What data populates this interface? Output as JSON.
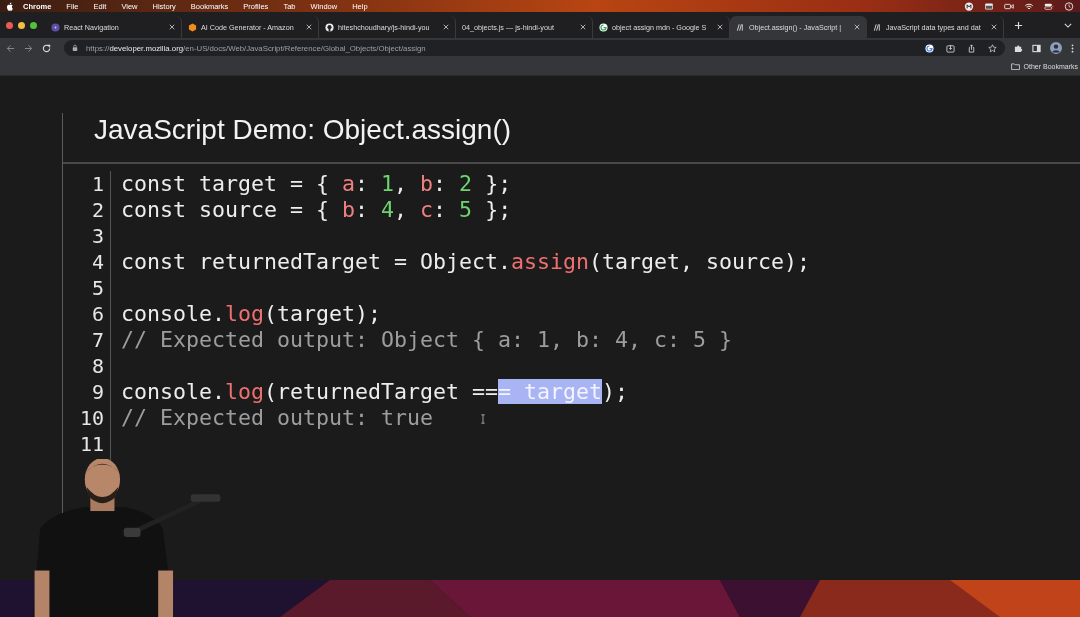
{
  "menu_bar": {
    "items": [
      {
        "label": "Chrome",
        "kind": "app"
      },
      {
        "label": "File",
        "kind": "menu"
      },
      {
        "label": "Edit",
        "kind": "menu"
      },
      {
        "label": "View",
        "kind": "menu"
      },
      {
        "label": "History",
        "kind": "menu"
      },
      {
        "label": "Bookmarks",
        "kind": "menu"
      },
      {
        "label": "Profiles",
        "kind": "menu"
      },
      {
        "label": "Tab",
        "kind": "menu"
      },
      {
        "label": "Window",
        "kind": "menu"
      },
      {
        "label": "Help",
        "kind": "menu"
      }
    ]
  },
  "tabs": [
    {
      "title": "React Navigation",
      "selected": false
    },
    {
      "title": "AI Code Generator - Amazon",
      "selected": false
    },
    {
      "title": "hiteshchoudhary/js-hindi-you",
      "selected": false
    },
    {
      "title": "04_objects.js — js-hindi-yout",
      "selected": false
    },
    {
      "title": "object assign mdn - Google S",
      "selected": false
    },
    {
      "title": "Object.assign() - JavaScript |",
      "selected": true
    },
    {
      "title": "JavaScript data types and dat",
      "selected": false
    }
  ],
  "address_bar": {
    "host_prefix": "https://",
    "host": "developer.mozilla.org",
    "path": "/en-US/docs/Web/JavaScript/Reference/Global_Objects/Object/assign"
  },
  "bookmarks_bar": {
    "items": [
      "Other Bookmarks"
    ]
  },
  "demo": {
    "title": "JavaScript Demo: Object.assign()",
    "lines": [
      {
        "number": "1",
        "tokens": [
          {
            "text": "const target = { ",
            "kind": "plain"
          },
          {
            "text": "a",
            "kind": "prop"
          },
          {
            "text": ": ",
            "kind": "plain"
          },
          {
            "text": "1",
            "kind": "number"
          },
          {
            "text": ", ",
            "kind": "plain"
          },
          {
            "text": "b",
            "kind": "prop"
          },
          {
            "text": ": ",
            "kind": "plain"
          },
          {
            "text": "2",
            "kind": "number"
          },
          {
            "text": " };",
            "kind": "plain"
          }
        ]
      },
      {
        "number": "2",
        "tokens": [
          {
            "text": "const source = { ",
            "kind": "plain"
          },
          {
            "text": "b",
            "kind": "prop"
          },
          {
            "text": ": ",
            "kind": "plain"
          },
          {
            "text": "4",
            "kind": "number"
          },
          {
            "text": ", ",
            "kind": "plain"
          },
          {
            "text": "c",
            "kind": "prop"
          },
          {
            "text": ": ",
            "kind": "plain"
          },
          {
            "text": "5",
            "kind": "number"
          },
          {
            "text": " };",
            "kind": "plain"
          }
        ]
      },
      {
        "number": "3"
      },
      {
        "number": "4",
        "tokens": [
          {
            "text": "const returnedTarget = Object.",
            "kind": "plain"
          },
          {
            "text": "assign",
            "kind": "method"
          },
          {
            "text": "(target, source);",
            "kind": "plain"
          }
        ]
      },
      {
        "number": "5"
      },
      {
        "number": "6",
        "tokens": [
          {
            "text": "console.",
            "kind": "plain"
          },
          {
            "text": "log",
            "kind": "method"
          },
          {
            "text": "(target);",
            "kind": "plain"
          }
        ]
      },
      {
        "number": "7",
        "tokens": [
          {
            "text": "// Expected output: Object { a: 1, b: 4, c: 5 }",
            "kind": "comment"
          }
        ]
      },
      {
        "number": "8"
      },
      {
        "number": "9",
        "tokens": [
          {
            "text": "console.",
            "kind": "plain"
          },
          {
            "text": "log",
            "kind": "method"
          },
          {
            "text": "(returnedTarget ==",
            "kind": "plain"
          },
          {
            "text": "= target",
            "kind": "selected"
          },
          {
            "text": ");",
            "kind": "plain"
          }
        ]
      },
      {
        "number": "10",
        "tokens": [
          {
            "text": "// Expected output: true",
            "kind": "comment"
          }
        ]
      },
      {
        "number": "11"
      }
    ]
  }
}
